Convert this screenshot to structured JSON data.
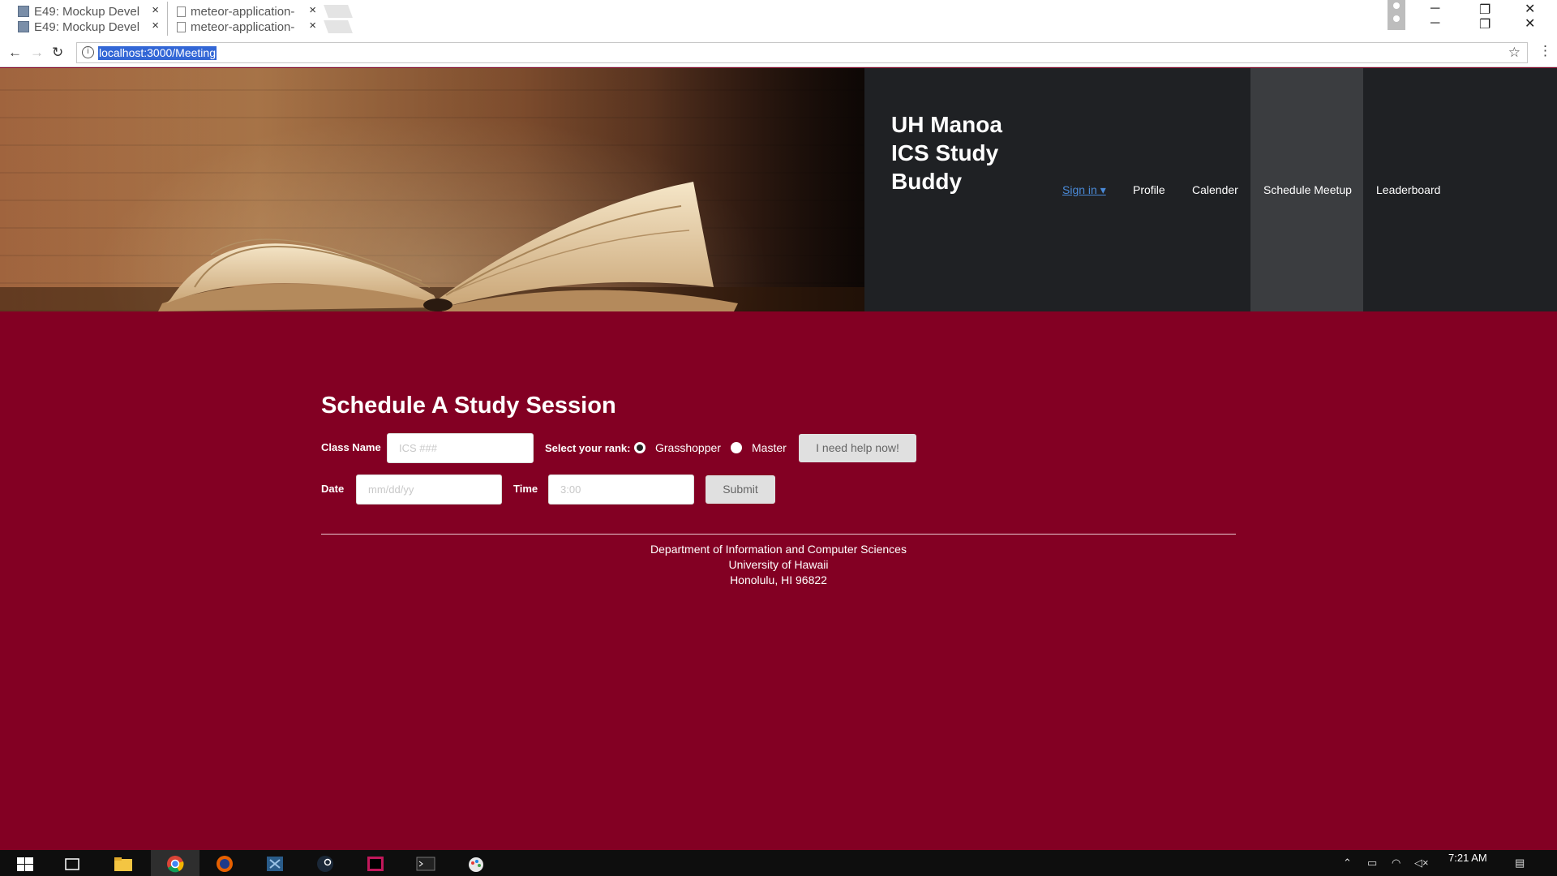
{
  "browser": {
    "tabs_row1": [
      {
        "title": "E49: Mockup Devel"
      },
      {
        "title": "meteor-application-"
      }
    ],
    "tabs_row2": [
      {
        "title": "E49: Mockup Devel"
      },
      {
        "title": "meteor-application-"
      }
    ],
    "tab_close": "×",
    "url": "localhost:3000/Meeting",
    "icons": [
      "back-icon",
      "forward-icon",
      "reload-icon",
      "info-icon",
      "star-icon",
      "menu-icon"
    ]
  },
  "header": {
    "brand_line1": "UH Manoa",
    "brand_line2": "ICS Study",
    "brand_line3": "Buddy",
    "nav": {
      "signin": "Sign in ▾",
      "profile": "Profile",
      "calender": "Calender",
      "schedule": "Schedule Meetup",
      "leaderboard": "Leaderboard"
    }
  },
  "form": {
    "title": "Schedule A Study Session",
    "class_label": "Class Name",
    "class_placeholder": "ICS ###",
    "rank_label": "Select your rank:",
    "rank_options": [
      "Grasshopper",
      "Master"
    ],
    "rank_selected": "Grasshopper",
    "help_button": "I need help now!",
    "date_label": "Date",
    "date_placeholder": "mm/dd/yy",
    "time_label": "Time",
    "time_placeholder": "3:00",
    "submit_button": "Submit"
  },
  "footer": {
    "line1": "Department of Information and Computer Sciences",
    "line2": "University of Hawaii",
    "line3": "Honolulu, HI 96822"
  },
  "taskbar": {
    "clock": "7:21 AM",
    "apps": [
      "windows-icon",
      "task-view-icon",
      "file-explorer-icon",
      "chrome-icon",
      "firefox-icon",
      "visual-studio-icon",
      "steam-icon",
      "intellij-icon",
      "terminal-icon",
      "paint-icon"
    ]
  },
  "colors": {
    "page_bg": "#830023",
    "navbar_bg": "#1f2124",
    "nav_active_bg": "#3b3d40",
    "link_blue": "#4a8ad8"
  }
}
